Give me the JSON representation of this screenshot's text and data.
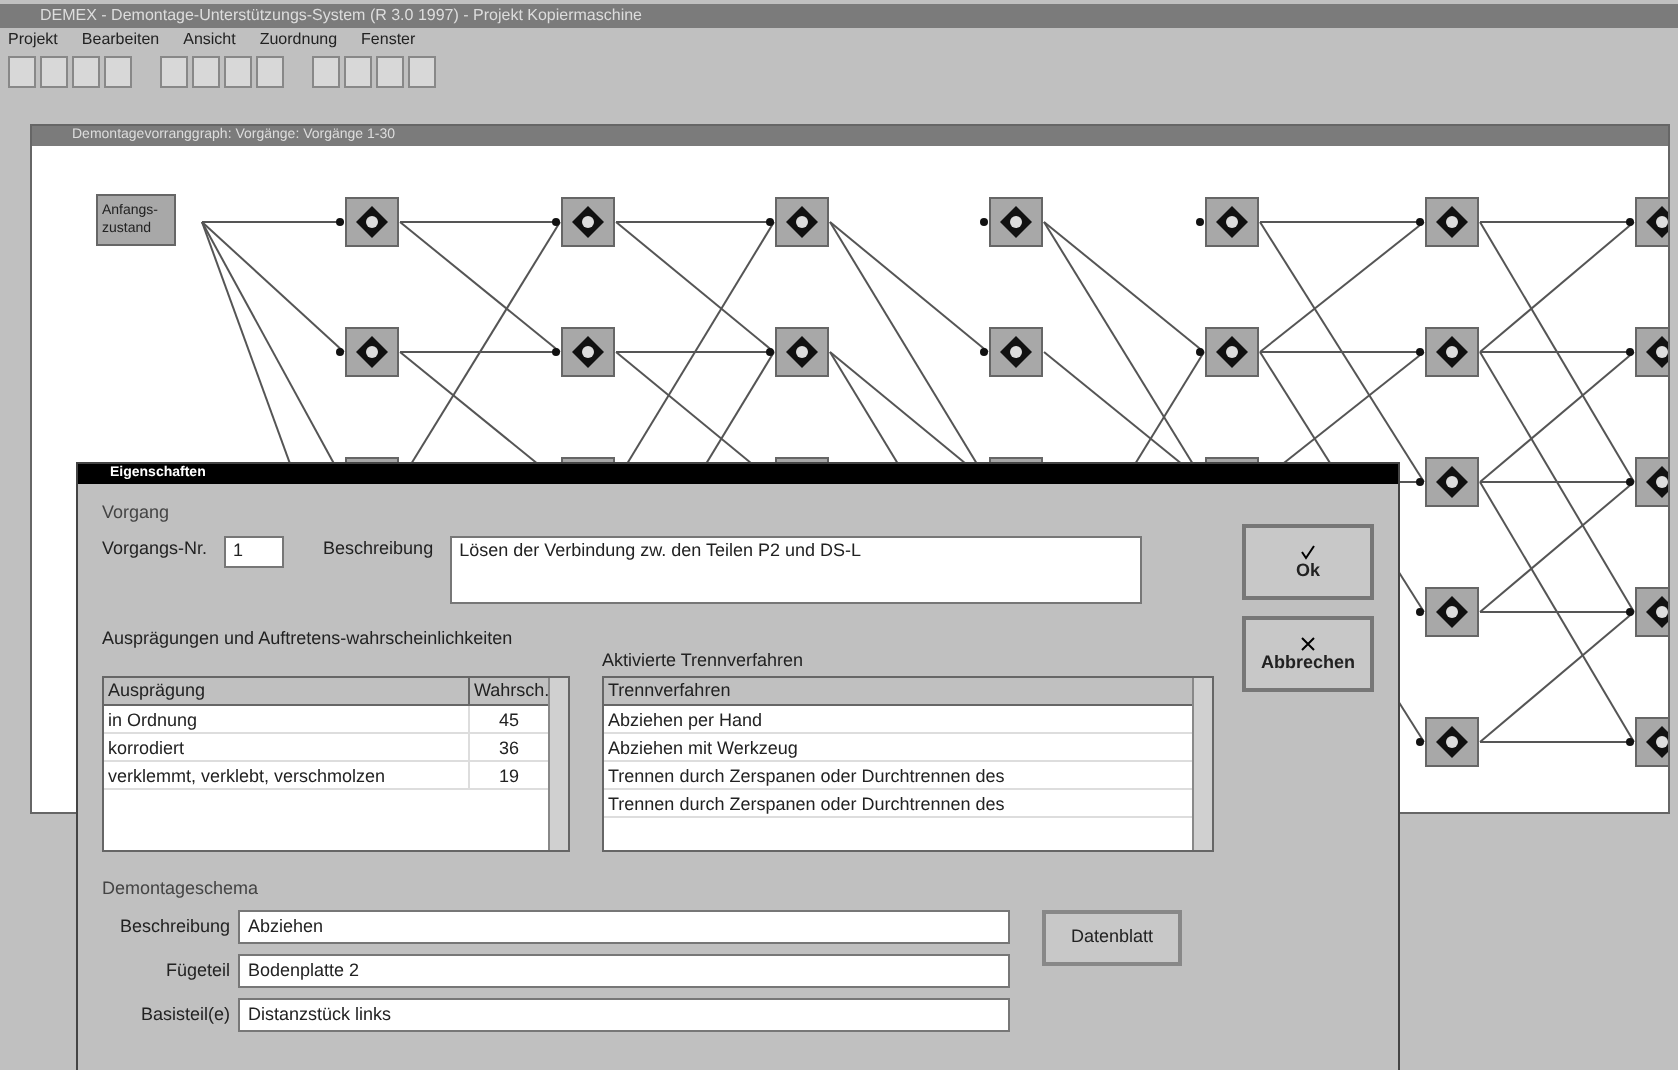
{
  "window": {
    "title": "DEMEX - Demontage-Unterstützungs-System (R 3.0 1997) - Projekt Kopiermaschine"
  },
  "menu": [
    "Projekt",
    "Bearbeiten",
    "Ansicht",
    "Zuordnung",
    "Fenster"
  ],
  "graph_window": {
    "title": "Demontagevorranggraph: Vorgänge: Vorgänge 1-30",
    "start_node": "Anfangs-zustand"
  },
  "dialog": {
    "title": "Eigenschaften",
    "vorgang": {
      "group": "Vorgang",
      "nr_label": "Vorgangs-Nr.",
      "nr": "1",
      "desc_label": "Beschreibung",
      "desc": "Lösen der Verbindung zw. den Teilen P2 und DS-L"
    },
    "buttons": [
      {
        "label": "Ok",
        "kind": "ok"
      },
      {
        "label": "Abbrechen",
        "kind": "cancel"
      }
    ],
    "auspraegungen": {
      "title": "Ausprägungen und Auftretens-wahrscheinlichkeiten",
      "columns": [
        "Ausprägung",
        "Wahrsch."
      ],
      "rows": [
        {
          "name": "in Ordnung",
          "value": "45"
        },
        {
          "name": "korrodiert",
          "value": "36"
        },
        {
          "name": "verklemmt, verklebt, verschmolzen",
          "value": "19"
        }
      ]
    },
    "trennverfahren": {
      "title": "Aktivierte Trennverfahren",
      "column": "Trennverfahren",
      "rows": [
        "Abziehen per Hand",
        "Abziehen mit Werkzeug",
        "Trennen durch Zerspanen oder Durchtrennen des",
        "Trennen durch Zerspanen oder Durchtrennen des"
      ]
    },
    "schema": {
      "group": "Demontageschema",
      "fields": [
        {
          "label": "Beschreibung",
          "value": "Abziehen"
        },
        {
          "label": "Fügeteil",
          "value": "Bodenplatte 2"
        },
        {
          "label": "Basisteil(e)",
          "value": "Distanzstück links"
        }
      ],
      "button": "Datenblatt"
    }
  }
}
